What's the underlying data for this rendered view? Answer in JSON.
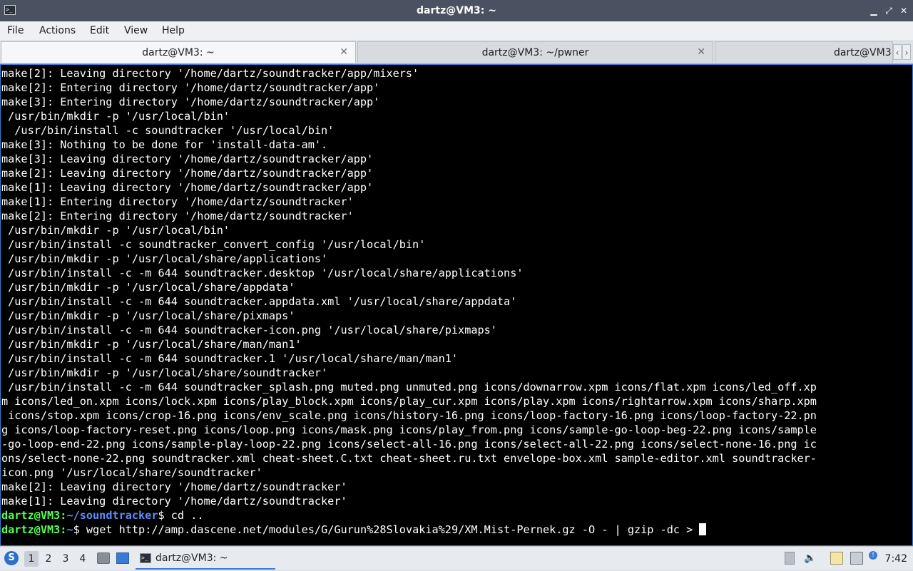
{
  "window": {
    "title": "dartz@VM3: ~",
    "controls": {
      "minimize": "▁",
      "maximize": "⤢",
      "close": "✕"
    }
  },
  "menu": [
    "File",
    "Actions",
    "Edit",
    "View",
    "Help"
  ],
  "tabs": [
    {
      "label": "dartz@VM3: ~",
      "active": true
    },
    {
      "label": "dartz@VM3: ~/pwner",
      "active": false
    },
    {
      "label": "dartz@VM3",
      "active": false
    }
  ],
  "terminal": {
    "colors": {
      "background": "#000000",
      "text": "#ffffff",
      "prompt_user": "#55ff55",
      "prompt_path": "#5c8dff"
    },
    "lines": [
      "make[2]: Leaving directory '/home/dartz/soundtracker/app/mixers'",
      "make[2]: Entering directory '/home/dartz/soundtracker/app'",
      "make[3]: Entering directory '/home/dartz/soundtracker/app'",
      " /usr/bin/mkdir -p '/usr/local/bin'",
      "  /usr/bin/install -c soundtracker '/usr/local/bin'",
      "make[3]: Nothing to be done for 'install-data-am'.",
      "make[3]: Leaving directory '/home/dartz/soundtracker/app'",
      "make[2]: Leaving directory '/home/dartz/soundtracker/app'",
      "make[1]: Leaving directory '/home/dartz/soundtracker/app'",
      "make[1]: Entering directory '/home/dartz/soundtracker'",
      "make[2]: Entering directory '/home/dartz/soundtracker'",
      " /usr/bin/mkdir -p '/usr/local/bin'",
      " /usr/bin/install -c soundtracker_convert_config '/usr/local/bin'",
      " /usr/bin/mkdir -p '/usr/local/share/applications'",
      " /usr/bin/install -c -m 644 soundtracker.desktop '/usr/local/share/applications'",
      " /usr/bin/mkdir -p '/usr/local/share/appdata'",
      " /usr/bin/install -c -m 644 soundtracker.appdata.xml '/usr/local/share/appdata'",
      " /usr/bin/mkdir -p '/usr/local/share/pixmaps'",
      " /usr/bin/install -c -m 644 soundtracker-icon.png '/usr/local/share/pixmaps'",
      " /usr/bin/mkdir -p '/usr/local/share/man/man1'",
      " /usr/bin/install -c -m 644 soundtracker.1 '/usr/local/share/man/man1'",
      " /usr/bin/mkdir -p '/usr/local/share/soundtracker'",
      " /usr/bin/install -c -m 644 soundtracker_splash.png muted.png unmuted.png icons/downarrow.xpm icons/flat.xpm icons/led_off.xp",
      "m icons/led_on.xpm icons/lock.xpm icons/play_block.xpm icons/play_cur.xpm icons/play.xpm icons/rightarrow.xpm icons/sharp.xpm",
      " icons/stop.xpm icons/crop-16.png icons/env_scale.png icons/history-16.png icons/loop-factory-16.png icons/loop-factory-22.pn",
      "g icons/loop-factory-reset.png icons/loop.png icons/mask.png icons/play_from.png icons/sample-go-loop-beg-22.png icons/sample",
      "-go-loop-end-22.png icons/sample-play-loop-22.png icons/select-all-16.png icons/select-all-22.png icons/select-none-16.png ic",
      "ons/select-none-22.png soundtracker.xml cheat-sheet.C.txt cheat-sheet.ru.txt envelope-box.xml sample-editor.xml soundtracker-",
      "icon.png '/usr/local/share/soundtracker'",
      "make[2]: Leaving directory '/home/dartz/soundtracker'",
      "make[1]: Leaving directory '/home/dartz/soundtracker'"
    ],
    "prompts": [
      {
        "user": "dartz@VM3",
        "sep": ":",
        "path": "~/soundtracker",
        "symbol": "$",
        "command": " cd .."
      },
      {
        "user": "dartz@VM3",
        "sep": ":",
        "path": "~",
        "symbol": "$",
        "command": " wget http://amp.dascene.net/modules/G/Gurun%28Slovakia%29/XM.Mist-Pernek.gz -O - | gzip -dc > "
      }
    ]
  },
  "taskbar": {
    "workspaces": [
      "1",
      "2",
      "3",
      "4"
    ],
    "active_workspace": "1",
    "task": {
      "label": "dartz@VM3: ~"
    },
    "clock": "7:42",
    "icons": [
      "start-menu-icon",
      "file-manager-icon",
      "desktop-icon",
      "terminal-icon",
      "trash-icon",
      "volume-icon",
      "clipboard-icon",
      "network-icon",
      "notification-icon"
    ]
  }
}
